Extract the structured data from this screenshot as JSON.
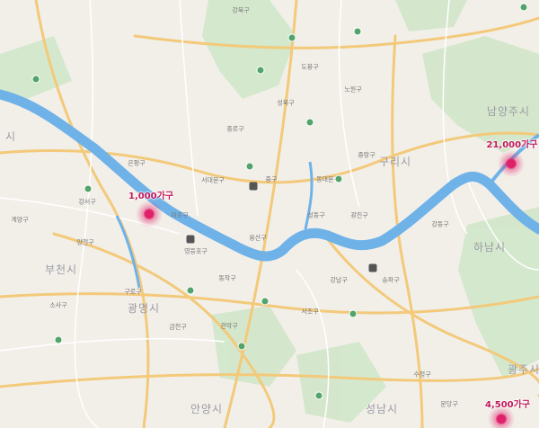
{
  "colors": {
    "land": "#f2efe9",
    "river": "#6fb2e8",
    "park": "#cfe6c8",
    "road_major": "#f3c97a",
    "road_minor": "#ffffff",
    "marker": "#e0216a",
    "marker_label": "#c2185b"
  },
  "region_labels": {
    "namyangju": "남양주시",
    "guri": "구리시",
    "hanam": "하남시",
    "bucheon": "부천시",
    "gwangmyeong": "광명시",
    "gwangju": "광주시",
    "anyang": "안양시",
    "seongnam": "성남시",
    "goyang": "시"
  },
  "district_labels": {
    "gangbuk": "강북구",
    "dobong": "도봉구",
    "nowon": "노원구",
    "jungnang": "중랑구",
    "seongbuk": "성북구",
    "dongdaemun": "동대문구",
    "jongno": "종로구",
    "jung": "중구",
    "yongsan": "용산구",
    "mapo": "마포구",
    "seodaemun": "서대문구",
    "eunpyeong": "은평구",
    "gangseo": "강서구",
    "yangcheon": "양천구",
    "guro": "구로구",
    "geumcheon": "금천구",
    "yeongdeungpo": "영등포구",
    "dongjak": "동작구",
    "gwanak": "관악구",
    "seocho": "서초구",
    "gangnam": "강남구",
    "songpa": "송파구",
    "gangdong": "강동구",
    "gwangjin": "광진구",
    "seongdong": "성동구",
    "sujeong": "수정구",
    "bundang": "분당구",
    "sosa": "소사구",
    "gyeyang": "계양구"
  },
  "markers": [
    {
      "label": "1,000가구"
    },
    {
      "label": "21,000가구"
    },
    {
      "label": "4,500가구"
    }
  ]
}
